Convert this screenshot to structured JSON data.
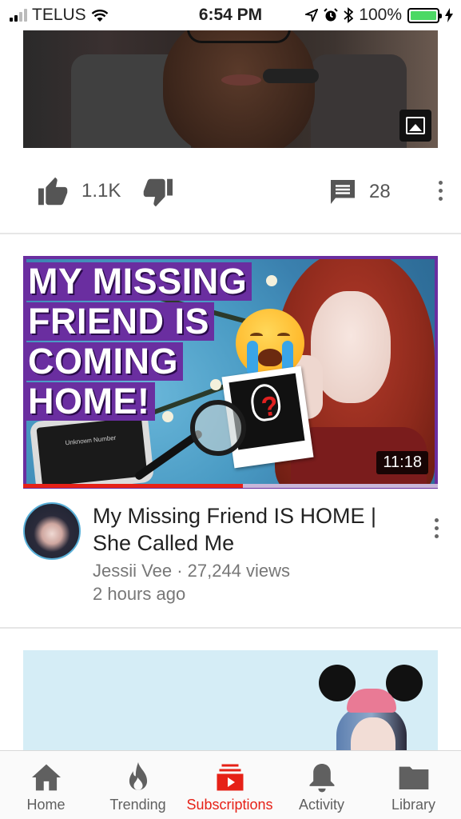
{
  "status_bar": {
    "carrier": "TELUS",
    "time": "6:54 PM",
    "battery_percent": "100%",
    "battery_level": 1.0,
    "signal_bars_filled": 2,
    "signal_bars_total": 4
  },
  "top_video": {
    "likes": "1.1K",
    "comments": "28"
  },
  "featured_video": {
    "thumbnail_text": [
      "MY MISSING",
      "FRIEND IS",
      "COMING",
      "HOME!"
    ],
    "phone_screen_text": "Unknown Number",
    "duration": "11:18",
    "watched_progress": 0.53,
    "title": "My Missing Friend IS HOME | She Called Me",
    "channel": "Jessii Vee",
    "views": "27,244 views",
    "separator": "·",
    "posted": "2 hours ago"
  },
  "tabs": [
    {
      "label": "Home",
      "icon": "home-icon",
      "active": false
    },
    {
      "label": "Trending",
      "icon": "flame-icon",
      "active": false
    },
    {
      "label": "Subscriptions",
      "icon": "subscriptions-icon",
      "active": true
    },
    {
      "label": "Activity",
      "icon": "bell-icon",
      "active": false
    },
    {
      "label": "Library",
      "icon": "folder-icon",
      "active": false
    }
  ],
  "colors": {
    "accent_red": "#e62117",
    "thumbnail_purple": "#6a2ea0",
    "battery_green": "#4cd964",
    "icon_grey": "#555555"
  }
}
